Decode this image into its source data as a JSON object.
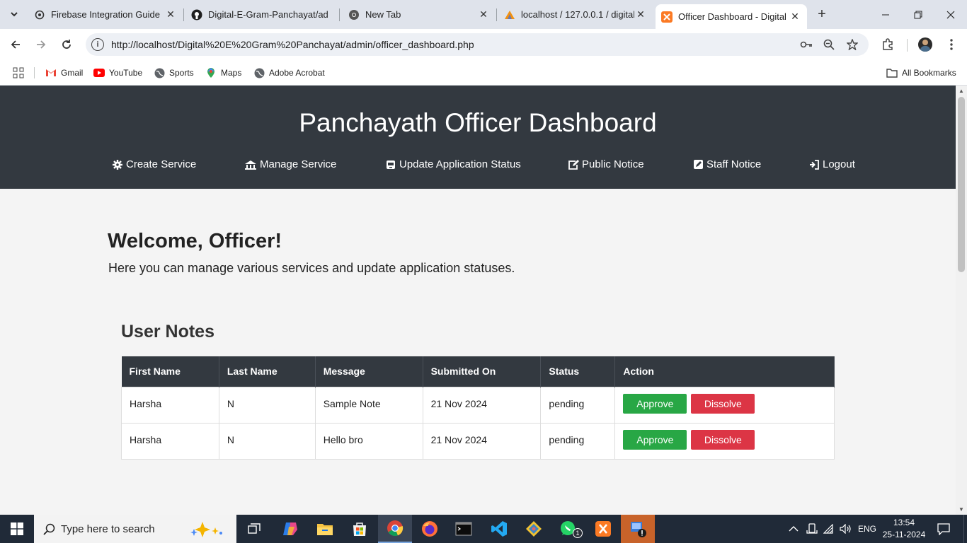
{
  "browser": {
    "tabs": [
      {
        "title": "Firebase Integration Guide",
        "icon": "openai-icon"
      },
      {
        "title": "Digital-E-Gram-Panchayat/ad",
        "icon": "github-icon"
      },
      {
        "title": "New Tab",
        "icon": "chrome-icon"
      },
      {
        "title": "localhost / 127.0.0.1 / digital",
        "icon": "phpmyadmin-icon"
      },
      {
        "title": "Officer Dashboard - Digital E",
        "icon": "xampp-icon",
        "active": true
      }
    ],
    "url": "http://localhost/Digital%20E%20Gram%20Panchayat/admin/officer_dashboard.php",
    "bookmarks": [
      {
        "label": "Gmail",
        "icon": "gmail-icon"
      },
      {
        "label": "YouTube",
        "icon": "youtube-icon"
      },
      {
        "label": "Sports",
        "icon": "globe-icon"
      },
      {
        "label": "Maps",
        "icon": "maps-icon"
      },
      {
        "label": "Adobe Acrobat",
        "icon": "globe-icon"
      }
    ],
    "all_bookmarks": "All Bookmarks"
  },
  "page": {
    "header_title": "Panchayath Officer Dashboard",
    "nav": [
      {
        "label": "Create Service",
        "icon": "gear-icon"
      },
      {
        "label": "Manage Service",
        "icon": "building-icon"
      },
      {
        "label": "Update Application Status",
        "icon": "inbox-icon"
      },
      {
        "label": "Public Notice",
        "icon": "edit-icon"
      },
      {
        "label": "Staff Notice",
        "icon": "pencil-square-icon"
      },
      {
        "label": "Logout",
        "icon": "sign-in-icon"
      }
    ],
    "welcome": "Welcome, Officer!",
    "subtitle": "Here you can manage various services and update application statuses.",
    "notes_title": "User Notes",
    "table": {
      "headers": [
        "First Name",
        "Last Name",
        "Message",
        "Submitted On",
        "Status",
        "Action"
      ],
      "rows": [
        {
          "first": "Harsha",
          "last": "N",
          "message": "Sample Note",
          "submitted": "21 Nov 2024",
          "status": "pending"
        },
        {
          "first": "Harsha",
          "last": "N",
          "message": "Hello bro",
          "submitted": "21 Nov 2024",
          "status": "pending"
        }
      ],
      "approve_label": "Approve",
      "dissolve_label": "Dissolve"
    }
  },
  "taskbar": {
    "search_placeholder": "Type here to search",
    "language": "ENG",
    "time": "13:54",
    "date": "25-11-2024",
    "whatsapp_badge": "1"
  },
  "colors": {
    "header_bg": "#333940",
    "approve": "#28a745",
    "dissolve": "#dc3545"
  }
}
